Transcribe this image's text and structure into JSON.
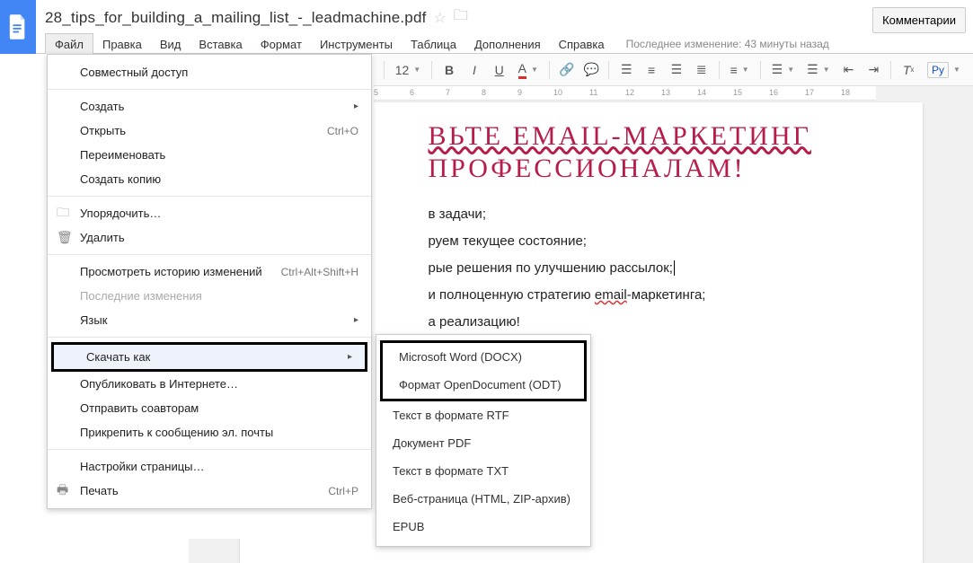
{
  "header": {
    "title": "28_tips_for_building_a_mailing_list_-_leadmachine.pdf",
    "comments_button": "Комментарии",
    "last_edit": "Последнее изменение: 43 минуты назад"
  },
  "menubar": [
    "Файл",
    "Правка",
    "Вид",
    "Вставка",
    "Формат",
    "Инструменты",
    "Таблица",
    "Дополнения",
    "Справка"
  ],
  "toolbar": {
    "font_size": "12",
    "text_color_letter": "A",
    "spellcheck_label": "Ру"
  },
  "ruler_ticks": [
    "5",
    "6",
    "7",
    "8",
    "9",
    "10",
    "11",
    "12",
    "13",
    "14",
    "15",
    "16",
    "17",
    "18"
  ],
  "document": {
    "heading_line1": "ВЬТЕ EMAIL-МАРКЕТИНГ",
    "heading_line2": "ПРОФЕССИОНАЛАМ!",
    "lines": [
      {
        "pre": "в задачи;",
        "u": "",
        "post": ""
      },
      {
        "pre": "руем текущее состояние;",
        "u": "",
        "post": ""
      },
      {
        "pre": "рые решения по улучшению рассылок;",
        "u": "",
        "post": ""
      },
      {
        "pre": "и полноценную стратегию ",
        "u": "email",
        "post": "-маркетинга;"
      },
      {
        "pre": "а реализацию!",
        "u": "",
        "post": ""
      }
    ]
  },
  "file_menu": {
    "share": "Совместный доступ",
    "new": "Создать",
    "open": "Открыть",
    "open_shortcut": "Ctrl+O",
    "rename": "Переименовать",
    "make_copy": "Создать копию",
    "organize": "Упорядочить…",
    "delete": "Удалить",
    "revision_history": "Просмотреть историю изменений",
    "revision_shortcut": "Ctrl+Alt+Shift+H",
    "recent_changes": "Последние изменения",
    "language": "Язык",
    "download_as": "Скачать как",
    "publish": "Опубликовать в Интернете…",
    "email_collab": "Отправить соавторам",
    "email_attach": "Прикрепить к сообщению эл. почты",
    "page_setup": "Настройки страницы…",
    "print": "Печать",
    "print_shortcut": "Ctrl+P"
  },
  "download_submenu": {
    "docx": "Microsoft Word (DOCX)",
    "odt": "Формат OpenDocument (ODT)",
    "rtf": "Текст в формате RTF",
    "pdf": "Документ PDF",
    "txt": "Текст в формате TXT",
    "html": "Веб-страница (HTML, ZIP-архив)",
    "epub": "EPUB"
  }
}
